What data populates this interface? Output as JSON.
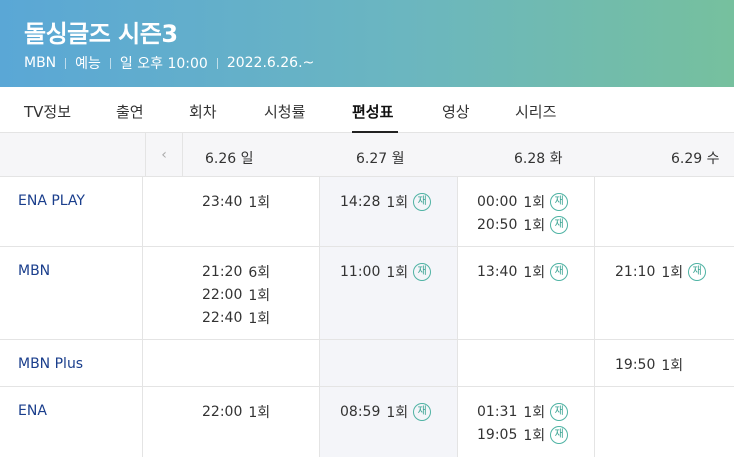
{
  "header": {
    "title": "돌싱글즈 시즌3",
    "meta": [
      "MBN",
      "예능",
      "일 오후 10:00",
      "2022.6.26.~"
    ],
    "gradient_colors": [
      "#5aa7d6",
      "#76c09e"
    ]
  },
  "tabs": [
    {
      "label": "TV정보"
    },
    {
      "label": "출연"
    },
    {
      "label": "회차"
    },
    {
      "label": "시청률"
    },
    {
      "label": "편성표",
      "active": true
    },
    {
      "label": "영상"
    },
    {
      "label": "시리즈"
    }
  ],
  "schedule": {
    "prev_icon": "chevron-left",
    "days": [
      "6.26 일",
      "6.27 월",
      "6.28 화",
      "6.29 수"
    ],
    "rerun_label": "재",
    "rerun_color": "#3aa392",
    "channels": [
      {
        "name": "ENA PLAY",
        "cells": [
          [
            {
              "time": "23:40",
              "ep": "1회"
            }
          ],
          [
            {
              "time": "14:28",
              "ep": "1회",
              "rerun": true
            }
          ],
          [
            {
              "time": "00:00",
              "ep": "1회",
              "rerun": true
            },
            {
              "time": "20:50",
              "ep": "1회",
              "rerun": true
            }
          ],
          []
        ]
      },
      {
        "name": "MBN",
        "cells": [
          [
            {
              "time": "21:20",
              "ep": "6회"
            },
            {
              "time": "22:00",
              "ep": "1회"
            },
            {
              "time": "22:40",
              "ep": "1회"
            }
          ],
          [
            {
              "time": "11:00",
              "ep": "1회",
              "rerun": true
            }
          ],
          [
            {
              "time": "13:40",
              "ep": "1회",
              "rerun": true
            }
          ],
          [
            {
              "time": "21:10",
              "ep": "1회",
              "rerun": true
            }
          ]
        ]
      },
      {
        "name": "MBN Plus",
        "cells": [
          [],
          [],
          [],
          [
            {
              "time": "19:50",
              "ep": "1회"
            }
          ]
        ]
      },
      {
        "name": "ENA",
        "cells": [
          [
            {
              "time": "22:00",
              "ep": "1회"
            }
          ],
          [
            {
              "time": "08:59",
              "ep": "1회",
              "rerun": true
            }
          ],
          [
            {
              "time": "01:31",
              "ep": "1회",
              "rerun": true
            },
            {
              "time": "19:05",
              "ep": "1회",
              "rerun": true
            }
          ],
          []
        ]
      }
    ]
  }
}
